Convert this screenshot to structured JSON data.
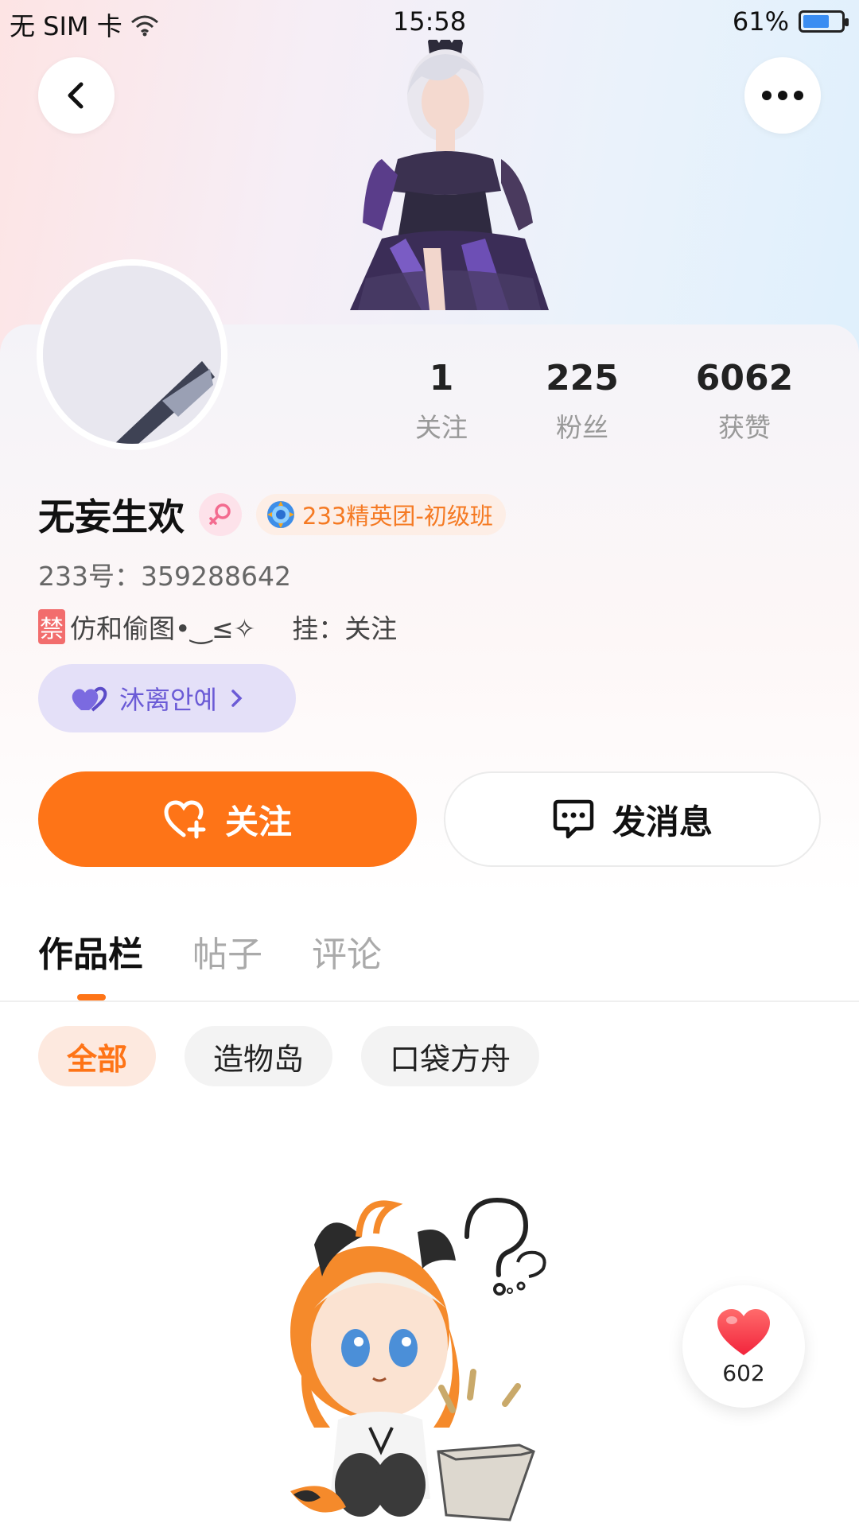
{
  "status_bar": {
    "carrier": "无 SIM 卡",
    "time": "15:58",
    "battery_percent": "61%",
    "battery_level": 0.61
  },
  "profile": {
    "name": "无妄生欢",
    "badge": "233精英团-初级班",
    "id_line": "233号：359288642",
    "bio_ban": "禁",
    "bio_text": "仿和偷图•‿≤✧",
    "bio_extra": "挂：关注",
    "relation_label": "沐离안예"
  },
  "stats": [
    {
      "value": "1",
      "label": "关注"
    },
    {
      "value": "225",
      "label": "粉丝"
    },
    {
      "value": "6062",
      "label": "获赞"
    }
  ],
  "actions": {
    "follow_label": "关注",
    "message_label": "发消息"
  },
  "tabs": [
    {
      "label": "作品栏",
      "active": true
    },
    {
      "label": "帖子",
      "active": false
    },
    {
      "label": "评论",
      "active": false
    }
  ],
  "chips": [
    {
      "label": "全部",
      "active": true
    },
    {
      "label": "造物岛",
      "active": false
    },
    {
      "label": "口袋方舟",
      "active": false
    }
  ],
  "like_button": {
    "count": "602"
  },
  "colors": {
    "accent": "#fe7417",
    "relation_purple": "#6b5bd6",
    "badge_text": "#f57a23"
  },
  "icons": [
    "back-icon",
    "more-icon",
    "wifi-icon",
    "battery-icon",
    "gender-female-icon",
    "badge-medal-icon",
    "heart-double-icon",
    "chevron-right-icon",
    "heart-plus-icon",
    "chat-bubble-icon",
    "heart-icon"
  ]
}
